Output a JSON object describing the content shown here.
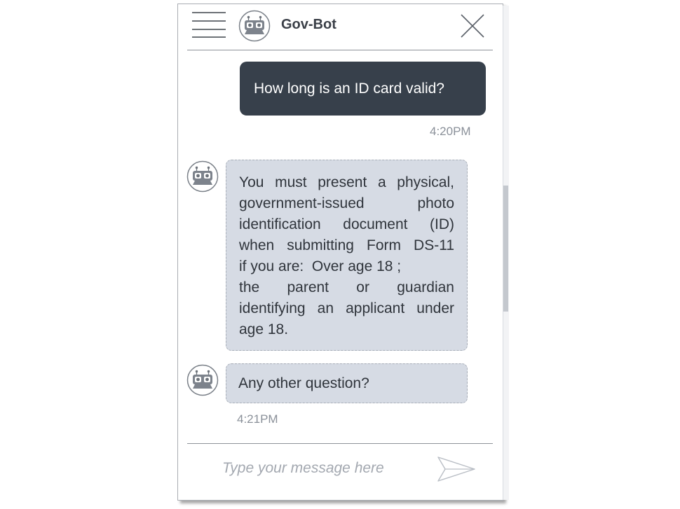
{
  "header": {
    "title": "Gov-Bot",
    "menu_icon": "hamburger-menu-icon",
    "avatar_icon": "robot-icon",
    "close_icon": "close-icon"
  },
  "messages": {
    "user_question": "How long is an ID card valid?",
    "user_time": "4:20PM",
    "bot_answer_lines": [
      "You must present a physical,",
      "government-issued photo",
      "identification document (ID)",
      "when submitting Form DS-11",
      "if you are:  Over age 18 ;",
      "the parent or guardian",
      "identifying an applicant under",
      "age 18."
    ],
    "bot_followup": "Any other question?",
    "bot_time": "4:21PM"
  },
  "composer": {
    "placeholder": "Type your message here",
    "value": "",
    "send_icon": "send-icon"
  },
  "colors": {
    "user_bubble": "#37404b",
    "bot_bubble": "#d6dbe4",
    "timestamp": "#8a9099",
    "title": "#3a3f47"
  }
}
